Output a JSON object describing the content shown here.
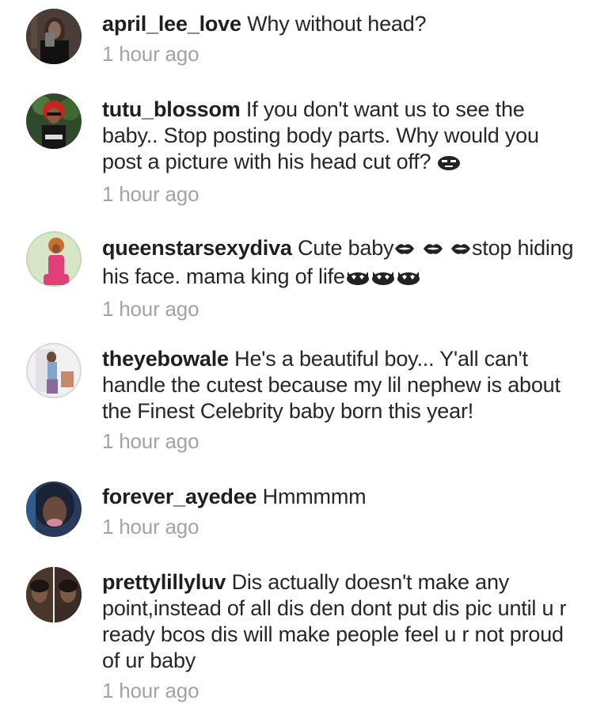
{
  "comments": [
    {
      "username": "april_lee_love",
      "text": "Why without head?",
      "time": "1 hour ago"
    },
    {
      "username": "tutu_blossom",
      "text": "If you don't want us to see the baby.. Stop posting body parts. Why would you post a picture with his head cut off?",
      "time": "1 hour ago"
    },
    {
      "username": "queenstarsexydiva",
      "text_a": "Cute baby",
      "text_b": "stop hiding his face. mama king of life",
      "time": "1 hour ago"
    },
    {
      "username": "theyebowale",
      "text": "He's a beautiful boy... Y'all can't handle the cutest because my lil nephew is about the Finest Celebrity baby born this year!",
      "time": "1 hour ago"
    },
    {
      "username": "forever_ayedee",
      "text": "Hmmmmm",
      "time": "1 hour ago"
    },
    {
      "username": "prettylillyluv",
      "text": "Dis actually doesn't make any point,instead of all dis den dont put dis pic until u r ready bcos dis will make people feel u r not proud of ur baby",
      "time": "1 hour ago"
    }
  ],
  "icons": {
    "emoji_1": "unamused-face-icon",
    "emoji_2": "kiss-mark-icon",
    "emoji_3": "heart-eyes-cat-icon"
  }
}
